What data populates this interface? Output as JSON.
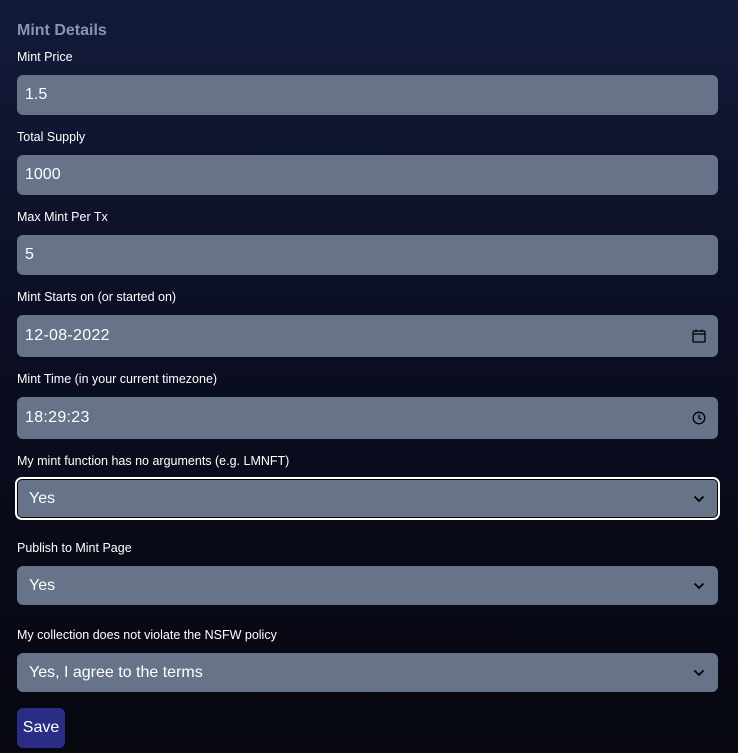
{
  "section": {
    "title": "Mint Details"
  },
  "fields": {
    "mint_price": {
      "label": "Mint Price",
      "value": "1.5"
    },
    "total_supply": {
      "label": "Total Supply",
      "value": "1000"
    },
    "max_mint_per_tx": {
      "label": "Max Mint Per Tx",
      "value": "5"
    },
    "mint_start_date": {
      "label": "Mint Starts on (or started on)",
      "value": "12-08-2022",
      "icon": "calendar-icon"
    },
    "mint_time": {
      "label": "Mint Time (in your current timezone)",
      "value": "18:29:23",
      "icon": "clock-icon"
    },
    "no_arguments": {
      "label": "My mint function has no arguments (e.g. LMNFT)",
      "value": "Yes",
      "icon": "chevron-down-icon"
    },
    "publish_to_mint_page": {
      "label": "Publish to Mint Page",
      "value": "Yes",
      "icon": "chevron-down-icon"
    },
    "nsfw_policy": {
      "label": "My collection does not violate the NSFW policy",
      "value": "Yes, I agree to the terms",
      "icon": "chevron-down-icon"
    }
  },
  "actions": {
    "save_label": "Save"
  },
  "colors": {
    "field_background": "#677389",
    "save_button": "#2b2c85",
    "section_title": "#8a93b8"
  }
}
